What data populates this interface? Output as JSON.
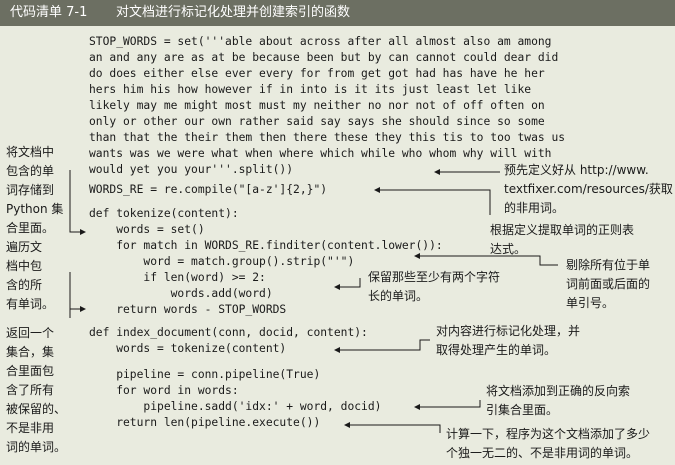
{
  "listing": {
    "label": "代码清单 7-1",
    "title": "对文档进行标记化处理并创建索引的函数"
  },
  "code": {
    "stop_words": [
      "STOP_WORDS = set('''able about across after all almost also am among",
      "an and any are as at be because been but by can cannot could dear did",
      "do does either else ever every for from get got had has have he her",
      "hers him his how however if in into is it its just least let like",
      "likely may me might most must my neither no nor not of off often on",
      "only or other our own rather said say says she should since so some",
      "than that the their them then there these they this tis to too twas us",
      "wants was we were what when where which while who whom why will with",
      "would yet you your'''.split())"
    ],
    "words_re": [
      "WORDS_RE = re.compile(\"[a-z']{2,}\")"
    ],
    "tokenize": [
      "def tokenize(content):",
      "    words = set()",
      "    for match in WORDS_RE.finditer(content.lower()):",
      "        word = match.group().strip(\"'\")",
      "        if len(word) >= 2:",
      "            words.add(word)",
      "    return words - STOP_WORDS"
    ],
    "index_document_a": [
      "def index_document(conn, docid, content):",
      "    words = tokenize(content)"
    ],
    "index_document_b": [
      "    pipeline = conn.pipeline(True)",
      "    for word in words:",
      "        pipeline.sadd('idx:' + word, docid)",
      "    return len(pipeline.execute())"
    ]
  },
  "left_notes": {
    "store_set": [
      "将文档中",
      "包含的单",
      "词存储到",
      "Python 集",
      "合里面。"
    ],
    "iterate": [
      "遍历文",
      "档中包",
      "含的所",
      "有单词。"
    ],
    "return_set": [
      "返回一个",
      "集合，集",
      "合里面包",
      "含了所有",
      "被保留的、",
      "不是非用",
      "词的单词。"
    ]
  },
  "right_notes": {
    "stop_words": [
      "预先定义好从 http://www.",
      "textfixer.com/resources/获取",
      "的非用词。"
    ],
    "regex": [
      "根据定义提取单词的正则表",
      "达式。"
    ],
    "strip_quotes": [
      "剔除所有位于单",
      "词前面或后面的",
      "单引号。"
    ],
    "keep_two": [
      "保留那些至少有两个字符",
      "长的单词。"
    ],
    "tokenize_content": [
      "对内容进行标记化处理，并",
      "取得处理产生的单词。"
    ],
    "add_to_index": [
      "将文档添加到正确的反向索",
      "引集合里面。"
    ],
    "count_words": [
      "计算一下，程序为这个文档添加了多少",
      "个独一无二的、不是非用词的单词。"
    ]
  }
}
